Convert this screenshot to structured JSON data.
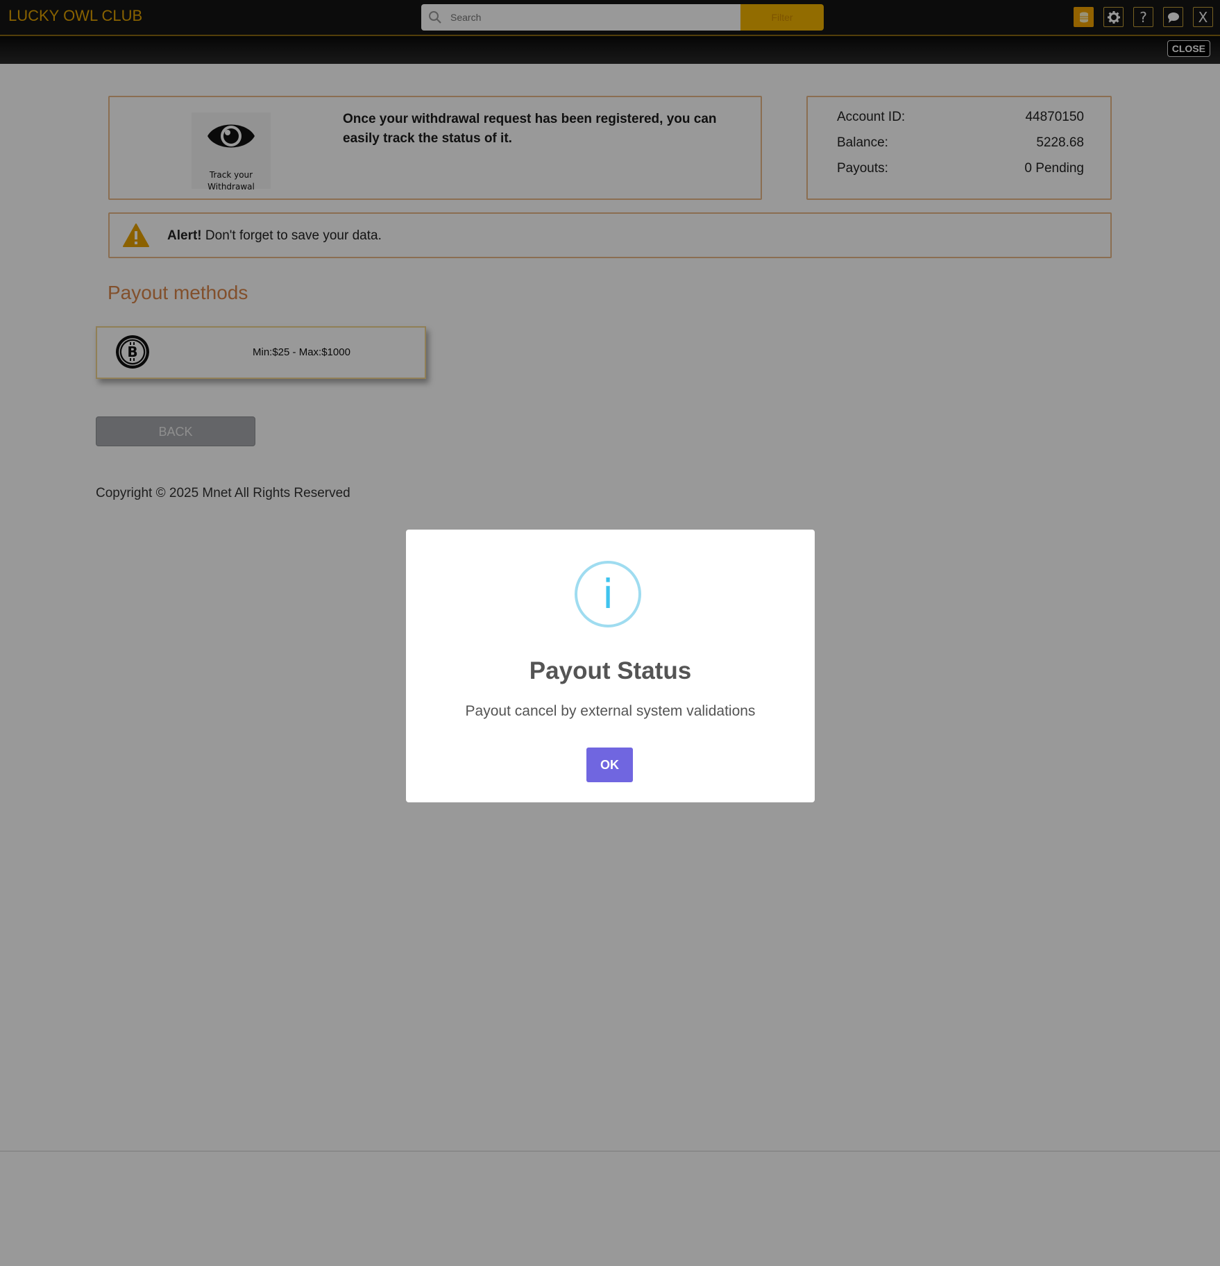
{
  "header": {
    "brand": "LUCKY OWL CLUB",
    "search_placeholder": "Search",
    "search_button_label": "Filter",
    "icons": [
      "coin-icon",
      "gear-icon",
      "help-icon",
      "chat-icon",
      "close-icon"
    ],
    "close_glyph": "X",
    "help_glyph": "?"
  },
  "subbar": {
    "close_label": "CLOSE"
  },
  "track": {
    "caption_line1": "Track your",
    "caption_line2": "Withdrawal",
    "message": "Once your withdrawal request has been registered, you can easily track the status of it."
  },
  "account": {
    "rows": [
      {
        "label": "Account ID:",
        "value": "44870150"
      },
      {
        "label": "Balance:",
        "value": "5228.68"
      },
      {
        "label": "Payouts:",
        "value": "0 Pending"
      }
    ]
  },
  "alert": {
    "strong": "Alert!",
    "text": " Don't forget to save your data."
  },
  "payout_methods": {
    "title": "Payout methods",
    "methods": [
      {
        "icon": "bitcoin-icon",
        "limits": "Min:$25 - Max:$1000"
      }
    ]
  },
  "back_label": "BACK",
  "copyright": "Copyright © 2025 Mnet All Rights Reserved",
  "modal": {
    "icon_glyph": "i",
    "title": "Payout Status",
    "message": "Payout cancel by external system validations",
    "ok_label": "OK"
  },
  "colors": {
    "accent": "#f4b400",
    "brand": "#e3a300",
    "card_border": "#e8b887",
    "payout_title": "#d9864a",
    "ok_button": "#7066e0",
    "info_icon": "#3fc3ee"
  }
}
